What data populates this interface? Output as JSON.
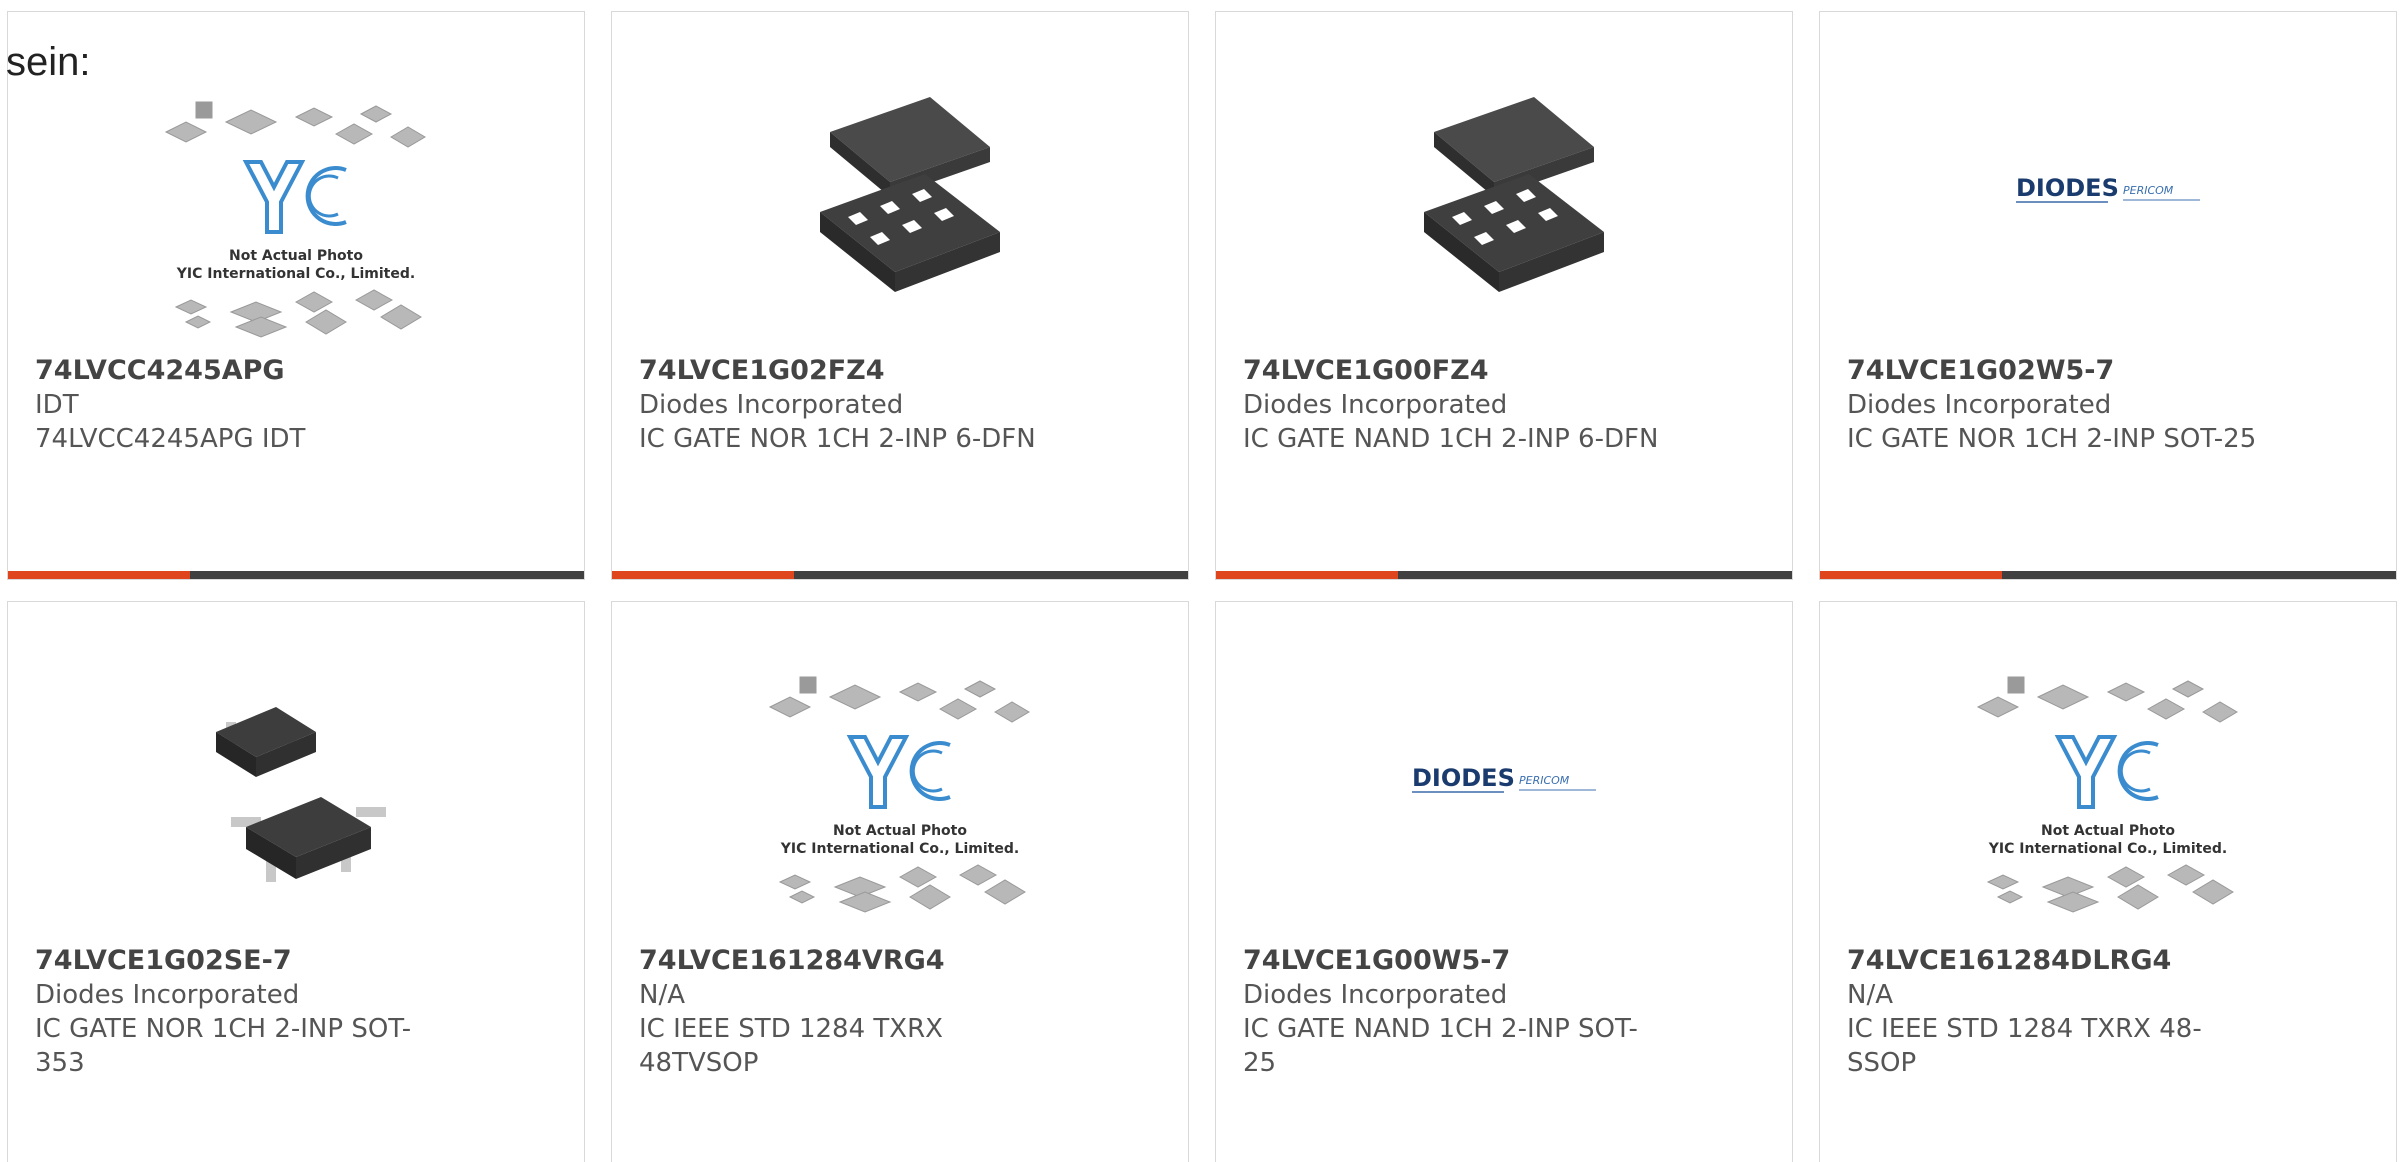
{
  "intro_text": "sein:",
  "placeholder_image": {
    "line1": "Not Actual Photo",
    "line2": "YIC International Co., Limited.",
    "logo": "YIC"
  },
  "diodes_logo": {
    "brand": "DIODES",
    "sub_brand": "PERICOM"
  },
  "products": [
    {
      "part_number": "74LVCC4245APG",
      "manufacturer": "IDT",
      "description": "74LVCC4245APG IDT",
      "image": "yic-placeholder"
    },
    {
      "part_number": "74LVCE1G02FZ4",
      "manufacturer": "Diodes Incorporated",
      "description": "IC GATE NOR 1CH 2-INP 6-DFN",
      "image": "dfn-package"
    },
    {
      "part_number": "74LVCE1G00FZ4",
      "manufacturer": "Diodes Incorporated",
      "description": "IC GATE NAND 1CH 2-INP 6-DFN",
      "image": "dfn-package"
    },
    {
      "part_number": "74LVCE1G02W5-7",
      "manufacturer": "Diodes Incorporated",
      "description": "IC GATE NOR 1CH 2-INP SOT-25",
      "image": "diodes-logo"
    },
    {
      "part_number": "74LVCE1G02SE-7",
      "manufacturer": "Diodes Incorporated",
      "description": "IC GATE NOR 1CH 2-INP SOT-353",
      "image": "sot-package"
    },
    {
      "part_number": "74LVCE161284VRG4",
      "manufacturer": "N/A",
      "description": "IC IEEE STD 1284 TXRX 48TVSOP",
      "image": "yic-placeholder"
    },
    {
      "part_number": "74LVCE1G00W5-7",
      "manufacturer": "Diodes Incorporated",
      "description": "IC GATE NAND 1CH 2-INP SOT-25",
      "image": "diodes-logo"
    },
    {
      "part_number": "74LVCE161284DLRG4",
      "manufacturer": "N/A",
      "description": "IC IEEE STD 1284 TXRX 48-SSOP",
      "image": "yic-placeholder"
    }
  ],
  "colors": {
    "accent": "#e0461e",
    "bar": "#404040",
    "border": "#d9d9d9"
  }
}
